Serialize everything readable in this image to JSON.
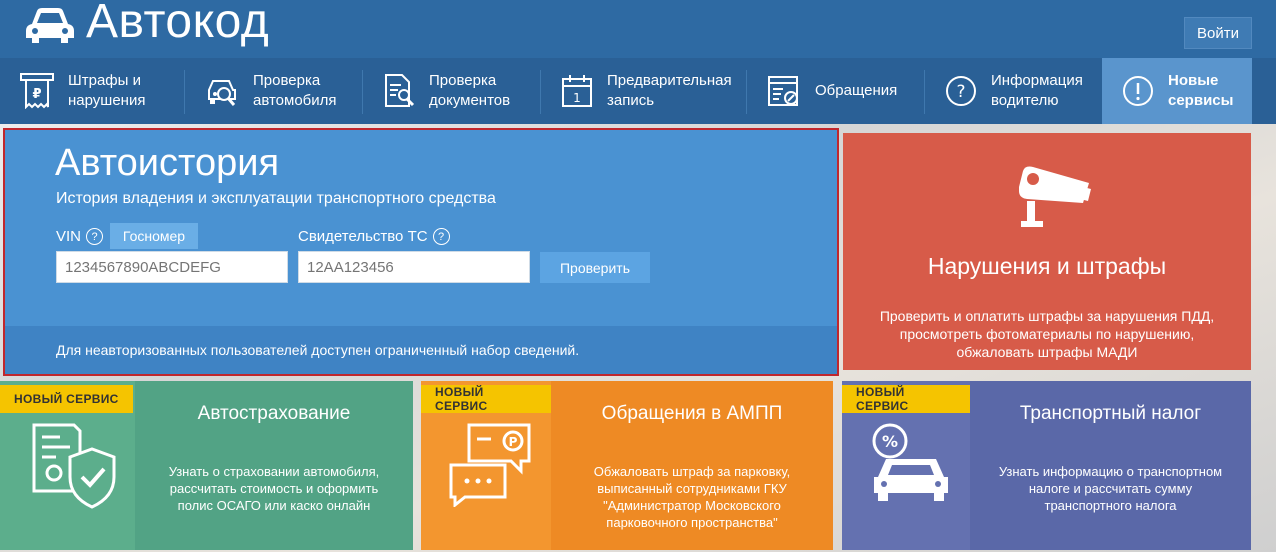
{
  "header": {
    "brand": "Автокод",
    "login_label": "Войти"
  },
  "nav": {
    "items": [
      {
        "label": "Штрафы и\nнарушения",
        "icon": "fine-receipt-icon"
      },
      {
        "label": "Проверка\nавтомобиля",
        "icon": "car-search-icon"
      },
      {
        "label": "Проверка\nдокументов",
        "icon": "document-search-icon"
      },
      {
        "label": "Предварительная\nзапись",
        "icon": "calendar-icon"
      },
      {
        "label": "Обращения",
        "icon": "appeal-form-icon"
      },
      {
        "label": "Информация\nводителю",
        "icon": "question-icon"
      },
      {
        "label": "Новые\nсервисы",
        "icon": "exclamation-icon"
      }
    ]
  },
  "history": {
    "title": "Автоистория",
    "subtitle": "История владения и эксплуатации транспортного средства",
    "vin_label": "VIN",
    "help_mark": "?",
    "gosnomer_tab": "Госномер",
    "cert_label": "Свидетельство ТС",
    "vin_placeholder": "1234567890ABCDEFG",
    "cert_placeholder": "12AA123456",
    "check_label": "Проверить",
    "footer": "Для неавторизованных пользователей доступен ограниченный набор сведений."
  },
  "violations": {
    "title": "Нарушения и штрафы",
    "text": "Проверить и оплатить штрафы за нарушения ПДД,\nпросмотреть фотоматериалы по нарушению,\nобжаловать штрафы МАДИ"
  },
  "cards": [
    {
      "badge": "НОВЫЙ СЕРВИС",
      "title": "Автострахование",
      "text": "Узнать о страховании автомобиля,\nрассчитать стоимость и оформить\nполис ОСАГО или каско онлайн",
      "icon": "insurance-shield-icon"
    },
    {
      "badge": "НОВЫЙ СЕРВИС",
      "title": "Обращения в АМПП",
      "text": "Обжаловать штраф за парковку,\nвыписанный сотрудниками ГКУ\n\"Администратор Московского\nпарковочного пространства\"",
      "icon": "parking-chat-icon"
    },
    {
      "badge": "НОВЫЙ СЕРВИС",
      "title": "Транспортный налог",
      "text": "Узнать информацию о транспортном\nналоге и рассчитать сумму\nтранспортного налога",
      "icon": "car-tax-icon"
    }
  ],
  "colors": {
    "header": "#2e6aa3",
    "nav": "#2a6096",
    "nav_active": "#5a95cd",
    "history": "#4a92d2",
    "violations": "#d75b49",
    "insurance_card": "#52a385",
    "ampp_card": "#ee8a24",
    "tax_card": "#5a68a8",
    "badge": "#f5c400"
  }
}
